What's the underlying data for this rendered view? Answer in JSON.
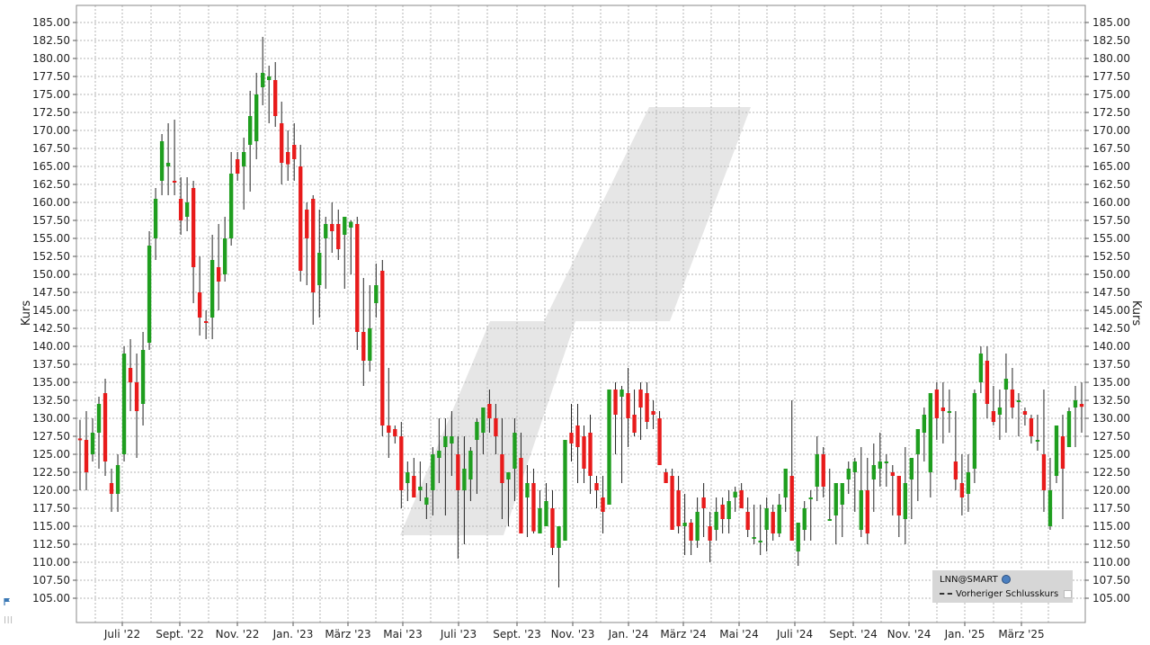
{
  "chart_data": {
    "type": "candlestick",
    "title": "",
    "ylabel_left": "Kurs",
    "ylabel_right": "Kurs",
    "ylim": [
      102.5,
      187.5
    ],
    "y_ticks": [
      "105.00",
      "107.50",
      "110.00",
      "112.50",
      "115.00",
      "117.50",
      "120.00",
      "122.50",
      "125.00",
      "127.50",
      "130.00",
      "132.50",
      "135.00",
      "137.50",
      "140.00",
      "142.50",
      "145.00",
      "147.50",
      "150.00",
      "152.50",
      "155.00",
      "157.50",
      "160.00",
      "162.50",
      "165.00",
      "167.50",
      "170.00",
      "172.50",
      "175.00",
      "177.50",
      "180.00",
      "182.50",
      "185.00"
    ],
    "x_ticks": [
      "Juli '22",
      "Sept. '22",
      "Nov. '22",
      "Jan. '23",
      "März '23",
      "Mai '23",
      "Juli '23",
      "Sept. '23",
      "Nov. '23",
      "Jan. '24",
      "März '24",
      "Mai '24",
      "Juli '24",
      "Sept. '24",
      "Nov. '24",
      "Jan. '25",
      "März '25"
    ],
    "grid": true,
    "legend": {
      "position": "bottom-right",
      "entries": [
        "LNN@SMART",
        "Vorheriger Schlusskurs"
      ]
    },
    "colors": {
      "up": "#1f9e1f",
      "down": "#e81b1b",
      "wick": "#222222",
      "grid": "#b5b5b5"
    },
    "candles": [
      [
        127.2,
        129.8,
        120.0,
        127.0
      ],
      [
        127.0,
        131.0,
        120.0,
        122.5
      ],
      [
        125.0,
        130.0,
        124.0,
        128.0
      ],
      [
        128.0,
        133.0,
        123.0,
        132.0
      ],
      [
        133.5,
        135.5,
        122.0,
        124.0
      ],
      [
        121.0,
        123.0,
        117.0,
        119.5
      ],
      [
        119.5,
        125.0,
        117.0,
        123.5
      ],
      [
        125.0,
        140.0,
        124.0,
        139.0
      ],
      [
        137.0,
        141.0,
        131.0,
        135.0
      ],
      [
        135.0,
        139.0,
        124.5,
        131.0
      ],
      [
        132.0,
        142.0,
        129.0,
        139.5
      ],
      [
        140.5,
        156.0,
        139.5,
        154.0
      ],
      [
        155.0,
        162.0,
        152.0,
        160.5
      ],
      [
        163.0,
        169.5,
        161.0,
        168.5
      ],
      [
        165.0,
        171.0,
        161.0,
        165.5
      ],
      [
        163.0,
        171.5,
        161.0,
        162.8
      ],
      [
        160.5,
        163.5,
        155.5,
        157.5
      ],
      [
        158.0,
        163.5,
        156.0,
        160.0
      ],
      [
        162.0,
        163.0,
        146.0,
        151.0
      ],
      [
        147.5,
        152.5,
        141.5,
        144.0
      ],
      [
        143.5,
        145.0,
        141.0,
        143.3
      ],
      [
        144.0,
        155.5,
        141.0,
        152.0
      ],
      [
        151.0,
        157.0,
        145.0,
        149.0
      ],
      [
        150.0,
        158.0,
        149.0,
        155.0
      ],
      [
        155.0,
        167.0,
        154.0,
        164.0
      ],
      [
        166.0,
        167.0,
        163.0,
        164.0
      ],
      [
        165.0,
        169.0,
        159.0,
        167.0
      ],
      [
        168.0,
        175.5,
        161.5,
        172.0
      ],
      [
        168.5,
        178.0,
        166.0,
        175.0
      ],
      [
        176.0,
        183.0,
        173.5,
        178.0
      ],
      [
        177.0,
        179.0,
        171.0,
        177.5
      ],
      [
        177.0,
        179.5,
        170.5,
        172.0
      ],
      [
        171.0,
        174.0,
        162.5,
        165.5
      ],
      [
        167.0,
        170.0,
        163.0,
        165.3
      ],
      [
        168.0,
        171.0,
        163.0,
        166.0
      ],
      [
        165.0,
        168.0,
        149.0,
        150.5
      ],
      [
        159.0,
        160.0,
        148.5,
        155.0
      ],
      [
        160.5,
        161.0,
        143.0,
        147.5
      ],
      [
        148.5,
        159.0,
        144.0,
        153.0
      ],
      [
        155.0,
        158.0,
        148.0,
        157.0
      ],
      [
        157.0,
        160.0,
        153.0,
        156.0
      ],
      [
        157.0,
        159.0,
        152.0,
        153.5
      ],
      [
        155.5,
        158.0,
        148.0,
        158.0
      ],
      [
        156.5,
        157.5,
        150.0,
        157.3
      ],
      [
        157.0,
        158.0,
        139.5,
        142.0
      ],
      [
        142.0,
        149.5,
        134.5,
        138.0
      ],
      [
        138.0,
        148.5,
        136.5,
        142.5
      ],
      [
        146.0,
        151.5,
        144.0,
        148.5
      ],
      [
        150.5,
        152.0,
        127.5,
        129.0
      ],
      [
        129.0,
        137.0,
        124.5,
        128.0
      ],
      [
        128.5,
        129.0,
        126.5,
        127.5
      ],
      [
        127.5,
        129.5,
        117.5,
        120.0
      ],
      [
        121.0,
        124.0,
        118.5,
        122.5
      ],
      [
        122.0,
        124.5,
        119.0,
        119.0
      ],
      [
        120.0,
        124.0,
        118.5,
        120.5
      ],
      [
        118.0,
        121.0,
        116.0,
        119.0
      ],
      [
        120.0,
        126.0,
        116.5,
        125.0
      ],
      [
        124.5,
        130.0,
        121.0,
        125.5
      ],
      [
        126.0,
        130.0,
        116.5,
        127.5
      ],
      [
        126.5,
        131.0,
        122.0,
        127.5
      ],
      [
        125.0,
        127.5,
        110.5,
        120.0
      ],
      [
        120.0,
        127.5,
        112.5,
        123.0
      ],
      [
        121.5,
        126.0,
        118.5,
        125.5
      ],
      [
        127.0,
        130.0,
        119.5,
        129.5
      ],
      [
        128.0,
        131.0,
        125.0,
        131.5
      ],
      [
        132.0,
        134.0,
        128.0,
        130.0
      ],
      [
        130.0,
        132.0,
        125.0,
        127.5
      ],
      [
        125.0,
        130.0,
        116.0,
        121.0
      ],
      [
        121.5,
        122.5,
        115.0,
        122.5
      ],
      [
        123.0,
        130.0,
        118.5,
        128.0
      ],
      [
        124.5,
        128.0,
        114.0,
        114.0
      ],
      [
        119.0,
        123.5,
        113.5,
        121.0
      ],
      [
        121.0,
        123.0,
        114.0,
        114.3
      ],
      [
        114.0,
        120.0,
        114.0,
        117.5
      ],
      [
        115.0,
        121.0,
        116.0,
        118.5
      ],
      [
        117.5,
        120.0,
        111.0,
        112.0
      ],
      [
        112.0,
        113.5,
        106.5,
        115.0
      ],
      [
        113.0,
        118.0,
        113.0,
        127.0
      ],
      [
        128.0,
        132.0,
        124.0,
        126.5
      ],
      [
        129.0,
        132.0,
        121.0,
        126.0
      ],
      [
        127.5,
        129.0,
        121.0,
        123.0
      ],
      [
        128.0,
        130.5,
        119.5,
        122.0
      ],
      [
        121.0,
        122.0,
        117.5,
        120.0
      ],
      [
        119.0,
        122.0,
        114.0,
        117.0
      ],
      [
        118.0,
        133.5,
        119.0,
        134.0
      ],
      [
        134.0,
        135.0,
        125.0,
        130.5
      ],
      [
        133.0,
        134.5,
        121.0,
        134.0
      ],
      [
        133.5,
        137.0,
        126.0,
        130.0
      ],
      [
        130.5,
        134.0,
        127.5,
        128.0
      ],
      [
        134.0,
        135.0,
        127.0,
        131.5
      ],
      [
        133.5,
        135.0,
        128.5,
        129.5
      ],
      [
        131.0,
        132.5,
        128.5,
        130.5
      ],
      [
        130.0,
        131.0,
        123.5,
        123.5
      ],
      [
        122.5,
        123.0,
        121.0,
        121.0
      ],
      [
        122.0,
        123.0,
        117.5,
        114.5
      ],
      [
        120.0,
        122.0,
        114.0,
        115.0
      ],
      [
        115.0,
        119.5,
        111.0,
        115.5
      ],
      [
        115.5,
        116.0,
        111.0,
        113.0
      ],
      [
        113.0,
        119.0,
        112.0,
        117.0
      ],
      [
        119.0,
        121.0,
        113.5,
        117.5
      ],
      [
        115.0,
        117.0,
        110.0,
        113.0
      ],
      [
        114.5,
        119.0,
        113.0,
        117.0
      ],
      [
        118.0,
        119.0,
        114.0,
        116.0
      ],
      [
        116.0,
        120.0,
        114.0,
        118.5
      ],
      [
        119.0,
        120.5,
        117.0,
        119.8
      ],
      [
        120.0,
        121.0,
        117.5,
        117.5
      ],
      [
        117.0,
        119.0,
        113.5,
        114.5
      ],
      [
        113.5,
        118.0,
        112.5,
        113.5
      ],
      [
        113.0,
        118.0,
        111.0,
        113.0
      ],
      [
        114.5,
        119.0,
        111.5,
        117.5
      ],
      [
        117.0,
        118.0,
        113.0,
        114.0
      ],
      [
        114.0,
        119.5,
        113.5,
        118.0
      ],
      [
        119.0,
        123.0,
        117.0,
        123.0
      ],
      [
        122.0,
        132.5,
        115.5,
        113.0
      ],
      [
        111.5,
        114.5,
        109.5,
        115.5
      ],
      [
        114.5,
        118.5,
        113.0,
        117.5
      ],
      [
        119.0,
        120.0,
        113.0,
        119.0
      ],
      [
        120.5,
        127.5,
        118.5,
        125.0
      ],
      [
        125.0,
        126.0,
        119.0,
        120.5
      ],
      [
        116.0,
        123.0,
        116.0,
        116.0
      ],
      [
        116.5,
        118.5,
        112.5,
        121.0
      ],
      [
        118.0,
        120.5,
        113.5,
        121.0
      ],
      [
        121.5,
        124.0,
        119.5,
        123.0
      ],
      [
        122.5,
        124.5,
        117.0,
        124.0
      ],
      [
        114.5,
        126.0,
        113.5,
        120.0
      ],
      [
        120.0,
        124.5,
        112.5,
        114.0
      ],
      [
        121.5,
        126.5,
        117.0,
        123.5
      ],
      [
        123.0,
        128.0,
        120.5,
        124.0
      ],
      [
        124.0,
        125.0,
        120.5,
        124.0
      ],
      [
        122.5,
        123.5,
        116.5,
        122.0
      ],
      [
        122.0,
        122.0,
        113.5,
        116.5
      ],
      [
        116.0,
        126.0,
        112.5,
        121.0
      ],
      [
        121.5,
        122.0,
        116.0,
        124.5
      ],
      [
        125.0,
        128.5,
        118.5,
        128.5
      ],
      [
        128.0,
        131.5,
        124.0,
        130.5
      ],
      [
        122.5,
        132.0,
        119.0,
        133.5
      ],
      [
        134.0,
        135.0,
        127.0,
        130.0
      ],
      [
        131.5,
        135.0,
        126.5,
        131.0
      ],
      [
        131.0,
        134.0,
        128.0,
        131.0
      ],
      [
        124.0,
        131.0,
        120.0,
        121.5
      ],
      [
        121.0,
        125.0,
        116.5,
        119.0
      ],
      [
        119.5,
        125.0,
        117.0,
        122.5
      ],
      [
        123.0,
        134.0,
        121.0,
        133.5
      ],
      [
        135.0,
        140.0,
        133.5,
        139.0
      ],
      [
        138.0,
        140.0,
        130.0,
        132.0
      ],
      [
        131.0,
        134.5,
        129.0,
        129.5
      ],
      [
        130.5,
        134.0,
        127.0,
        131.5
      ],
      [
        134.0,
        139.0,
        128.0,
        135.5
      ],
      [
        134.0,
        137.0,
        130.0,
        131.5
      ],
      [
        132.5,
        133.5,
        127.5,
        132.5
      ],
      [
        131.0,
        131.5,
        129.0,
        130.5
      ],
      [
        130.0,
        130.5,
        126.5,
        127.5
      ],
      [
        127.0,
        130.5,
        125.5,
        127.0
      ],
      [
        125.0,
        134.0,
        117.0,
        120.0
      ],
      [
        115.0,
        124.5,
        114.5,
        120.0
      ],
      [
        122.0,
        129.0,
        121.0,
        129.0
      ],
      [
        127.5,
        130.5,
        116.0,
        123.0
      ],
      [
        126.0,
        131.5,
        127.0,
        131.0
      ],
      [
        131.5,
        134.5,
        126.0,
        132.5
      ],
      [
        132.0,
        135.0,
        128.0,
        131.6
      ]
    ]
  }
}
